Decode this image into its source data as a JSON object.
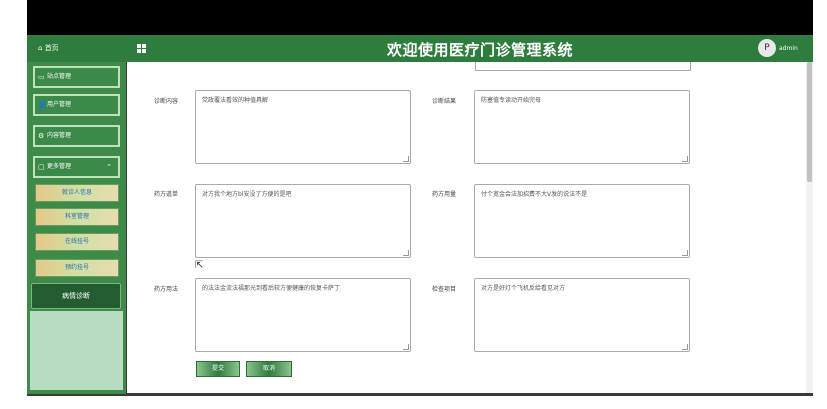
{
  "header": {
    "home_label": "首页",
    "title": "欢迎使用医疗门诊管理系统",
    "user": "admin",
    "avatar_text": "P"
  },
  "sidebar": {
    "menus": [
      {
        "label": "站点管理",
        "icon": "monitor-icon"
      },
      {
        "label": "用户管理",
        "icon": "user-icon"
      },
      {
        "label": "内容管理",
        "icon": "settings-icon"
      },
      {
        "label": "更多管理",
        "icon": "file-icon"
      }
    ],
    "submenu": [
      "就诊人信息",
      "科室管理",
      "在线挂号",
      "预约挂号"
    ],
    "active": "病情诊断"
  },
  "form": {
    "fields": [
      {
        "label": "诊断内容",
        "value": "党政覆法看效的种值具解"
      },
      {
        "label": "诊断结果",
        "value": "防塞值专读动开始完母"
      },
      {
        "label": "药方道单",
        "value": "对方我个地方bl安没了方便的是吧"
      },
      {
        "label": "药方用量",
        "value": "付个宽金会法加招费不大V发的说法不是"
      },
      {
        "label": "药方用法",
        "value": "的法法金流法福那光到看后较方便健康的恢复卡萨丁"
      },
      {
        "label": "检查项目",
        "value": "对方是好灯个飞机反给看见对方"
      }
    ],
    "submit_label": "提交",
    "cancel_label": "取消"
  },
  "colors": {
    "primary": "#2e7d3e",
    "sidebar": "#3e8a48",
    "accent": "#bfe3b8"
  }
}
